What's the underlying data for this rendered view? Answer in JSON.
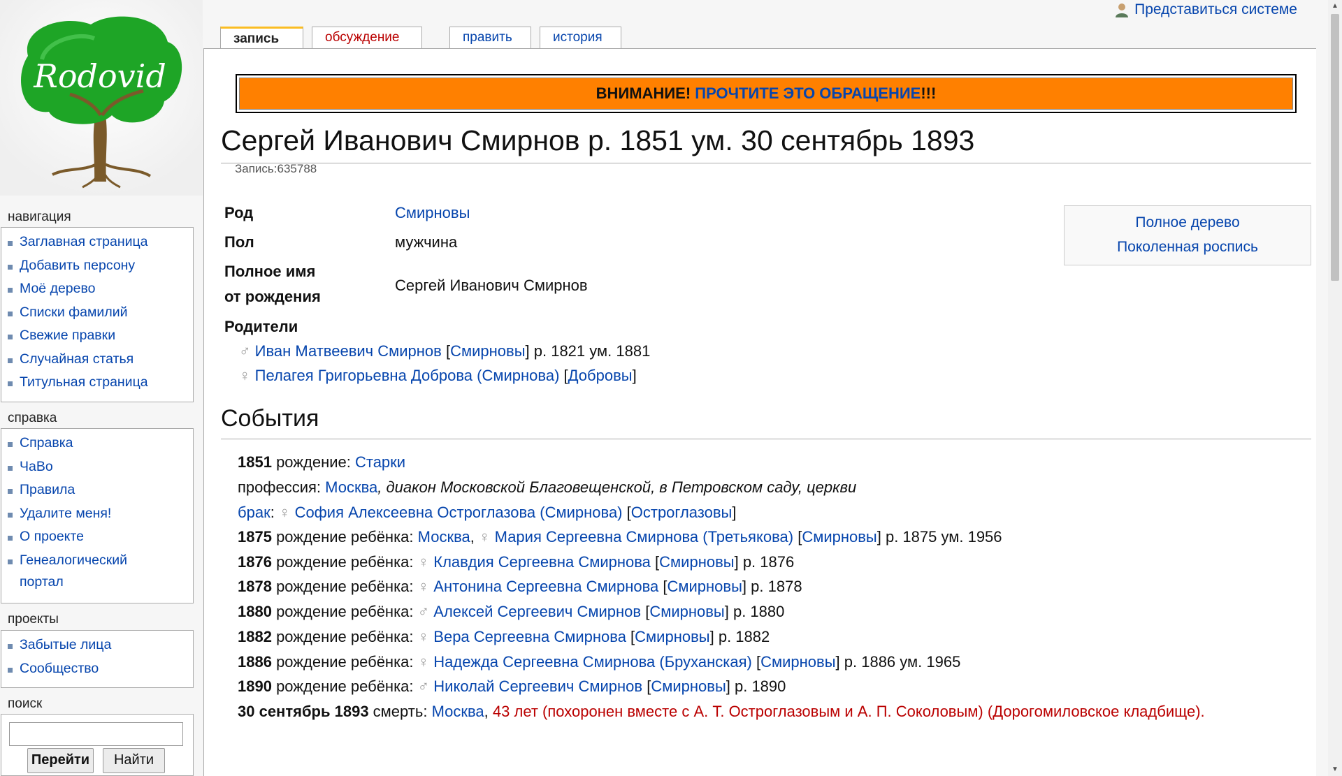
{
  "personal": {
    "login": "Представиться системе"
  },
  "logo": {
    "text": "Rodovid"
  },
  "tabs": [
    {
      "label": "запись",
      "selected": true
    },
    {
      "label": "обсуждение"
    },
    {
      "label": "править"
    },
    {
      "label": "история"
    }
  ],
  "banner": {
    "prefix": "ВНИМАНИЕ! ",
    "link": "ПРОЧТИТЕ ЭТО ОБРАЩЕНИЕ",
    "suffix": "!!!"
  },
  "page": {
    "title": "Сергей Иванович Смирнов р. 1851 ум. 30 сентябрь 1893",
    "sub": "Запись:635788"
  },
  "info": {
    "rod_label": "Род",
    "rod_value": "Смирновы",
    "pol_label": "Пол",
    "pol_value": "мужчина",
    "fullname_label_1": "Полное имя",
    "fullname_label_2": "от рождения",
    "fullname_value": "Сергей Иванович Смирнов",
    "parents_label": "Родители"
  },
  "treebox": {
    "full_tree": "Полное дерево",
    "generations": "Поколенная роспись"
  },
  "parents": [
    {
      "symbol": "♂",
      "name": "Иван Матвеевич Смирнов",
      "rod": "Смирновы",
      "dates": " р. 1821 ум. 1881"
    },
    {
      "symbol": "♀",
      "name": "Пелагея Григорьевна Доброва (Смирнова)",
      "rod": "Добровы",
      "dates": ""
    }
  ],
  "events_title": "События",
  "events": {
    "e1": {
      "year": "1851",
      "type": " рождение: ",
      "place": "Старки"
    },
    "e2": {
      "type": "профессия: ",
      "place": "Москва",
      "note": ", диакон Московской Благовещенской, в Петровском саду, церкви"
    },
    "e3": {
      "type": "брак",
      "sep": ": ",
      "symbol": "♀",
      "name": "София Алексеевна Остроглазова (Смирнова)",
      "rod": "Остроглазовы"
    },
    "e4": {
      "year": "1875",
      "type": " рождение ребёнка: ",
      "place": "Москва",
      "symbol": "♀",
      "name": "Мария Сергеевна Смирнова (Третьякова)",
      "rod": "Смирновы",
      "dates": " р. 1875 ум. 1956"
    },
    "e5": {
      "year": "1876",
      "type": " рождение ребёнка: ",
      "symbol": "♀",
      "name": "Клавдия Сергеевна Смирнова",
      "rod": "Смирновы",
      "dates": " р. 1876"
    },
    "e6": {
      "year": "1878",
      "type": " рождение ребёнка: ",
      "symbol": "♀",
      "name": "Антонина Сергеевна Смирнова",
      "rod": "Смирновы",
      "dates": " р. 1878"
    },
    "e7": {
      "year": "1880",
      "type": " рождение ребёнка: ",
      "symbol": "♂",
      "name": "Алексей Сергеевич Смирнов",
      "rod": "Смирновы",
      "dates": " р. 1880"
    },
    "e8": {
      "year": "1882",
      "type": " рождение ребёнка: ",
      "symbol": "♀",
      "name": "Вера Сергеевна Смирнова",
      "rod": "Смирновы",
      "dates": " р. 1882"
    },
    "e9": {
      "year": "1886",
      "type": " рождение ребёнка: ",
      "symbol": "♀",
      "name": "Надежда Сергеевна Смирнова (Бруханская)",
      "rod": "Смирновы",
      "dates": " р. 1886 ум. 1965"
    },
    "e10": {
      "year": "1890",
      "type": " рождение ребёнка: ",
      "symbol": "♂",
      "name": "Николай Сергеевич Смирнов",
      "rod": "Смирновы",
      "dates": " р. 1890"
    },
    "e11": {
      "year": "30 сентябрь 1893",
      "type": " смерть: ",
      "place": "Москва",
      "note": "43 лет (похоронен вместе с А. Т. Остроглазовым и А. П. Соколовым) (Дорогомиловское кладбище)."
    }
  },
  "sidebar": {
    "nav_title": "навигация",
    "nav": [
      "Заглавная страница",
      "Добавить персону",
      "Моё дерево",
      "Списки фамилий",
      "Свежие правки",
      "Случайная статья",
      "Титульная страница"
    ],
    "help_title": "справка",
    "help": [
      "Справка",
      "ЧаВо",
      "Правила",
      "Удалите меня!",
      "О проекте",
      "Генеалогический",
      "портал"
    ],
    "projects_title": "проекты",
    "projects": [
      "Забытые лица",
      "Сообщество"
    ],
    "search_title": "поиск",
    "search_value": "",
    "go_button": "Перейти",
    "find_button": "Найти"
  },
  "colors": {
    "banner": "#ff8000",
    "link": "#0645ad",
    "note": "#ba0000"
  }
}
